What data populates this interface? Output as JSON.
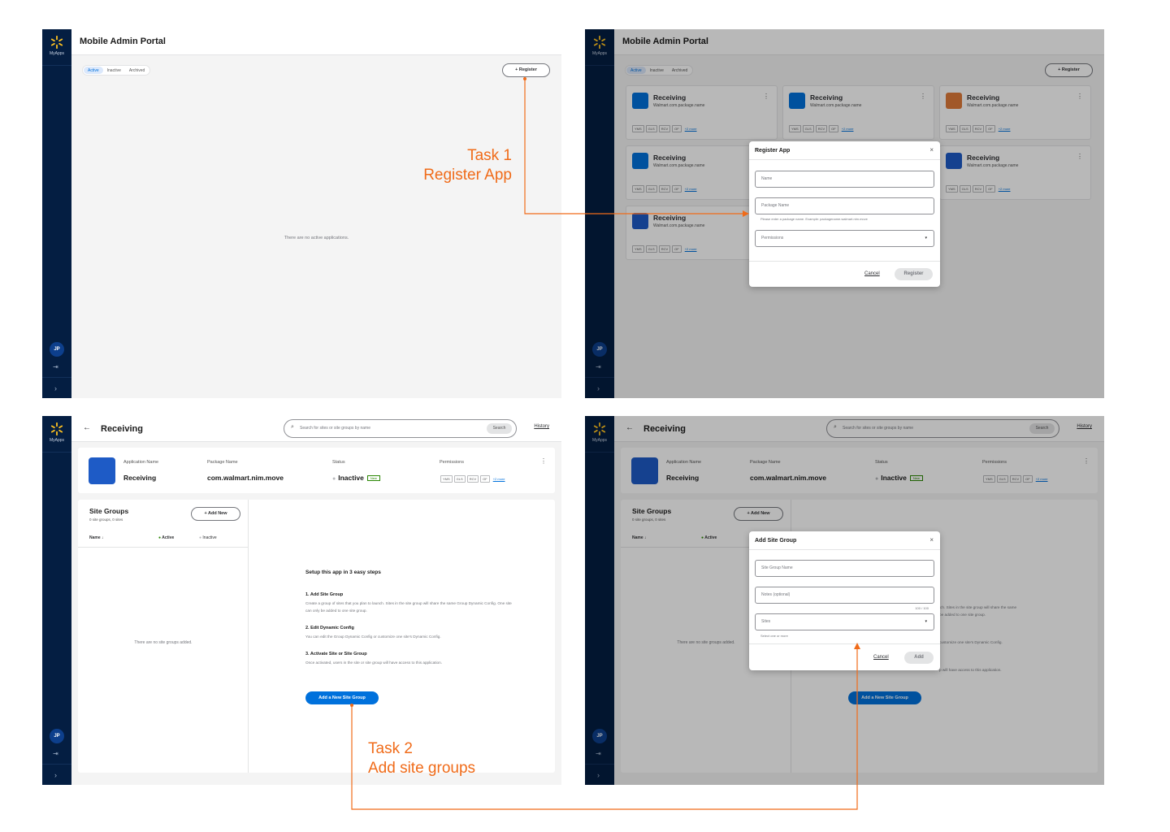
{
  "brand": {
    "myapps_label": "MyApps",
    "avatar_initials": "JP"
  },
  "portal": {
    "title": "Mobile Admin Portal",
    "tabs": [
      "Active",
      "Inactive",
      "Archived"
    ],
    "register_label": "+ Register",
    "empty_message": "There are no active applications."
  },
  "app_cards": [
    {
      "name": "Receiving",
      "package": "Walmart.com.package.name",
      "icon": "walmart-spark-icon",
      "chips": [
        "YMS",
        "GLS",
        "RCV",
        "OF"
      ],
      "more": "+2 more"
    },
    {
      "name": "Receiving",
      "package": "Walmart.com.package.name",
      "icon": "walmart-spark-icon",
      "chips": [
        "YMS",
        "GLS",
        "RCV",
        "OF"
      ],
      "more": "+2 more"
    },
    {
      "name": "Receiving",
      "package": "Walmart.com.package.name",
      "icon": "book-icon",
      "chips": [
        "YMS",
        "GLS",
        "RCV",
        "OF"
      ],
      "more": "+2 more"
    },
    {
      "name": "Receiving",
      "package": "Walmart.com.package.name",
      "icon": "walmart-spark-icon",
      "chips": [
        "YMS",
        "GLS",
        "RCV",
        "OF"
      ],
      "more": "+2 more"
    },
    {
      "name": "Receiving",
      "package": "Walmart.com.package.name",
      "icon": "app-store-icon",
      "chips": [
        "YMS",
        "GLS",
        "RCV",
        "OF"
      ],
      "more": "+2 more"
    },
    {
      "name": "Receiving",
      "package": "Walmart.com.package.name",
      "icon": "app-store-icon",
      "chips": [
        "YMS",
        "GLS",
        "RCV",
        "OF"
      ],
      "more": "+2 more"
    }
  ],
  "register_modal": {
    "title": "Register App",
    "name_placeholder": "Name",
    "package_placeholder": "Package Name",
    "package_helper": "Please enter a package name. Example: packagename.walmart.nim.move",
    "permissions_placeholder": "Permissions",
    "cancel_label": "Cancel",
    "register_label": "Register"
  },
  "app_detail": {
    "back_title": "Receiving",
    "search_placeholder": "Search for sites or site groups by name",
    "search_button": "Search",
    "history_link": "History",
    "headers": {
      "application_name": "Application Name",
      "package_name": "Package Name",
      "status": "Status",
      "permissions": "Permissions"
    },
    "application_name": "Receiving",
    "package_name": "com.walmart.nim.move",
    "status": "Inactive",
    "status_badge": "New",
    "chips": [
      "YMS",
      "GLS",
      "RCV",
      "OF"
    ],
    "more": "+2 more"
  },
  "site_groups": {
    "title": "Site Groups",
    "subtitle": "0 site groups, 0 sites",
    "add_new_label": "+ Add New",
    "col_name": "Name ↓",
    "col_active": "Active",
    "col_inactive": "Inactive",
    "empty_message": "There are no site groups added."
  },
  "setup": {
    "heading": "Setup this app in 3 easy steps",
    "steps": [
      {
        "title": "1. Add Site Group",
        "desc": "Create a group of sites that you plan to launch. Sites in the site group will share the same Group Dynamic Config. One site can only be added to one site group."
      },
      {
        "title": "2. Edit Dynamic Config",
        "desc": "You can edit the Group Dynamic Config or customize one site's Dynamic Config."
      },
      {
        "title": "3. Activate Site or Site Group",
        "desc": "Once activated, users in the site or site group will have access to this application."
      }
    ],
    "cta_label": "Add a New Site Group"
  },
  "site_modal": {
    "title": "Add Site Group",
    "name_placeholder": "Site Group Name",
    "notes_placeholder": "Notes (optional)",
    "notes_counter": "100 / 100",
    "sites_placeholder": "Sites",
    "sites_helper": "Select one or more",
    "cancel_label": "Cancel",
    "add_label": "Add"
  },
  "bg_partial": {
    "steps_fragment_1": "ich. Sites in the site group will share the same",
    "steps_fragment_2": "be added to one site group.",
    "steps_fragment_3": "customize one site's Dynamic Config.",
    "steps_fragment_4": "p will have access to this application."
  },
  "annotations": {
    "task1_line1": "Task 1",
    "task1_line2": "Register App",
    "task2_line1": "Task 2",
    "task2_line2": "Add site groups"
  },
  "colors": {
    "rail": "#041e42",
    "primary": "#0071dc",
    "annotation": "#f06b19",
    "active_dot": "#2a8703"
  }
}
